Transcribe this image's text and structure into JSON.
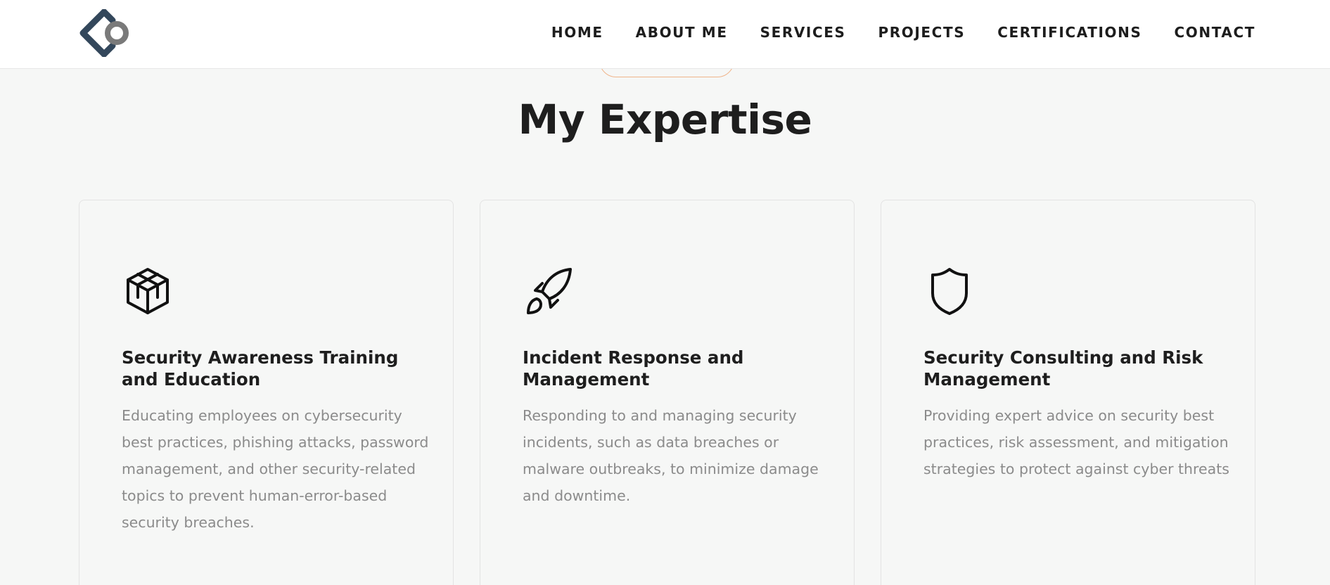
{
  "header": {
    "logo_icon": "brand-logo-icon",
    "nav": [
      {
        "label": "HOME"
      },
      {
        "label": "ABOUT ME"
      },
      {
        "label": "SERVICES"
      },
      {
        "label": "PROJECTS"
      },
      {
        "label": "CERTIFICATIONS"
      },
      {
        "label": "CONTACT"
      }
    ]
  },
  "section": {
    "title": "My Expertise"
  },
  "cards": [
    {
      "icon": "cube-icon",
      "title": "Security Awareness Training and Education",
      "description": "Educating employees on cybersecurity best practices, phishing attacks, password management, and other security-related topics to prevent human-error-based security breaches."
    },
    {
      "icon": "rocket-icon",
      "title": "Incident Response and Management",
      "description": "Responding to and managing security incidents, such as data breaches or malware outbreaks, to minimize damage and downtime."
    },
    {
      "icon": "shield-icon",
      "title": "Security Consulting and Risk Management",
      "description": "Providing expert advice on security best practices, risk assessment, and mitigation strategies to protect against cyber threats"
    }
  ],
  "colors": {
    "accent": "#f0b48a",
    "background": "#f6f7f6",
    "text": "#1e1e1e",
    "muted": "#8b8b8b",
    "logo_dark": "#33475b",
    "logo_grey": "#7a7a7a"
  }
}
